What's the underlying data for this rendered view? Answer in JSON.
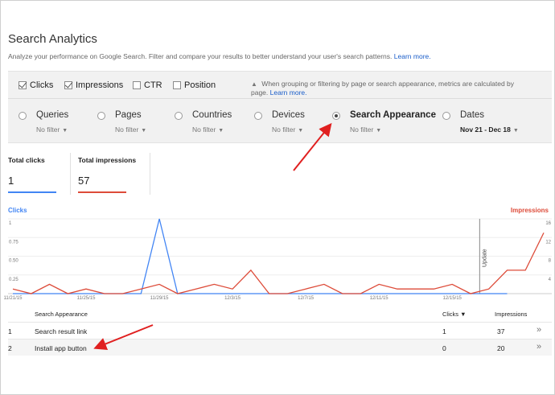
{
  "header": {
    "title": "Search Analytics",
    "subtitle": "Analyze your performance on Google Search. Filter and compare your results to better understand your user's search patterns.",
    "learn_more": "Learn more."
  },
  "metrics": [
    {
      "label": "Clicks",
      "checked": true
    },
    {
      "label": "Impressions",
      "checked": true
    },
    {
      "label": "CTR",
      "checked": false
    },
    {
      "label": "Position",
      "checked": false
    }
  ],
  "note": {
    "text": "When grouping or filtering by page or search appearance, metrics are calculated by page.",
    "learn_more": "Learn more."
  },
  "dimensions": [
    {
      "label": "Queries",
      "filter": "No filter",
      "selected": false
    },
    {
      "label": "Pages",
      "filter": "No filter",
      "selected": false
    },
    {
      "label": "Countries",
      "filter": "No filter",
      "selected": false
    },
    {
      "label": "Devices",
      "filter": "No filter",
      "selected": false
    },
    {
      "label": "Search Appearance",
      "filter": "No filter",
      "selected": true
    },
    {
      "label": "Dates",
      "filter": "Nov 21 - Dec 18",
      "selected": false
    }
  ],
  "totals": {
    "clicks_label": "Total clicks",
    "clicks_value": "1",
    "impressions_label": "Total impressions",
    "impressions_value": "57"
  },
  "chart_data": {
    "type": "line",
    "left_legend": "Clicks",
    "right_legend": "Impressions",
    "left_ticks": [
      "1",
      "0.75",
      "0.50",
      "0.25"
    ],
    "right_ticks": [
      "16",
      "12",
      "8",
      "4"
    ],
    "x_ticks": [
      "11/21/15",
      "11/25/15",
      "11/29/15",
      "12/3/15",
      "12/7/15",
      "12/11/15",
      "12/15/15"
    ],
    "annotation": "Update",
    "series": [
      {
        "name": "Clicks",
        "color": "#4285f4",
        "axis": "left",
        "ylim": [
          0,
          1
        ],
        "values": [
          0,
          0,
          0,
          0,
          0,
          0,
          0,
          0,
          1,
          0,
          0,
          0,
          0,
          0,
          0,
          0,
          0,
          0,
          0,
          0,
          0,
          0,
          0,
          0,
          0,
          0,
          0,
          0
        ]
      },
      {
        "name": "Impressions",
        "color": "#dd4b39",
        "axis": "right",
        "ylim": [
          0,
          16
        ],
        "values": [
          1,
          0,
          2,
          0,
          1,
          0,
          0,
          1,
          2,
          0,
          1,
          2,
          1,
          5,
          0,
          0,
          1,
          2,
          0,
          0,
          2,
          1,
          1,
          1,
          2,
          0,
          1,
          5,
          5,
          13
        ]
      }
    ]
  },
  "colors": {
    "clicks": "#4285f4",
    "impressions": "#dd4b39",
    "link": "#1a5dc9"
  },
  "table": {
    "headers": {
      "dimension": "Search Appearance",
      "clicks": "Clicks ▼",
      "impressions": "Impressions"
    },
    "rows": [
      {
        "index": "1",
        "name": "Search result link",
        "clicks": "1",
        "impressions": "37"
      },
      {
        "index": "2",
        "name": "Install app button",
        "clicks": "0",
        "impressions": "20"
      }
    ],
    "row_action_icon": "chevron-double-right-icon",
    "row_action_glyph": "»"
  }
}
